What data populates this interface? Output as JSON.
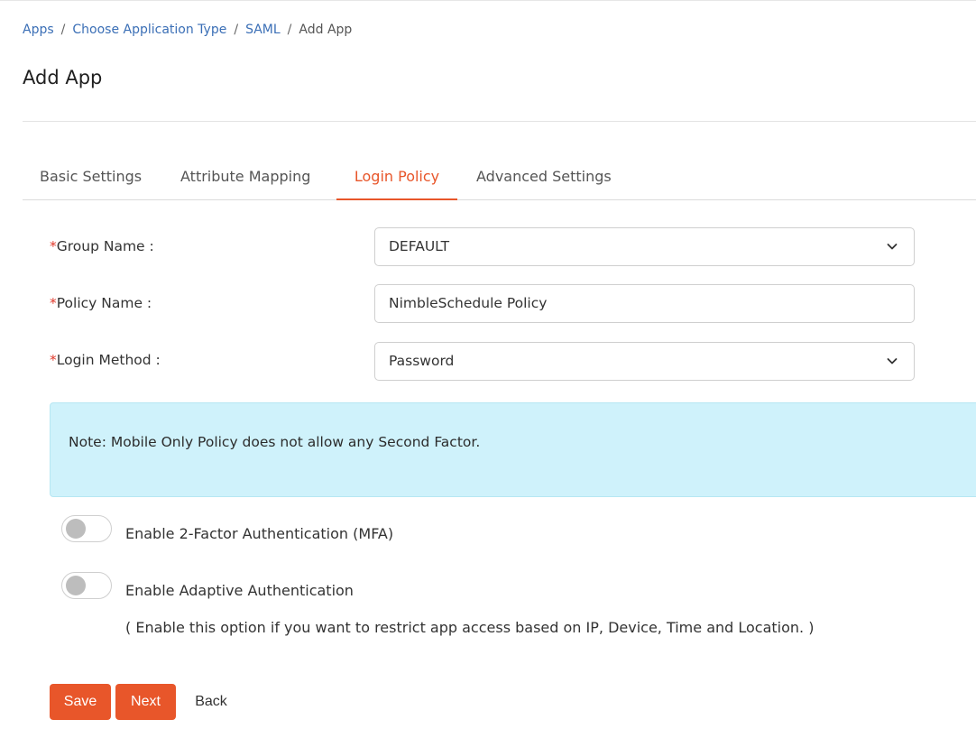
{
  "breadcrumb": {
    "items": [
      "Apps",
      "Choose Application Type",
      "SAML"
    ],
    "separator": "/",
    "current": "Add App"
  },
  "page": {
    "title": "Add App"
  },
  "tabs": [
    {
      "label": "Basic Settings",
      "active": false
    },
    {
      "label": "Attribute Mapping",
      "active": false
    },
    {
      "label": "Login Policy",
      "active": true
    },
    {
      "label": "Advanced Settings",
      "active": false
    }
  ],
  "form": {
    "required_mark": "*",
    "group_name": {
      "label": "Group Name :",
      "value": "DEFAULT",
      "icon": "chevron-down-icon"
    },
    "policy_name": {
      "label": "Policy Name :",
      "value": "NimbleSchedule Policy"
    },
    "login_method": {
      "label": "Login Method :",
      "value": "Password",
      "icon": "chevron-down-icon"
    }
  },
  "note": {
    "text": "Note: Mobile Only Policy does not allow any Second Factor."
  },
  "toggles": {
    "mfa": {
      "label": "Enable 2-Factor Authentication (MFA)",
      "enabled": false
    },
    "adaptive": {
      "label": "Enable Adaptive Authentication",
      "enabled": false,
      "hint": "( Enable this option if you want to restrict app access based on IP, Device, Time and Location. )"
    }
  },
  "actions": {
    "save": "Save",
    "next": "Next",
    "back": "Back"
  },
  "colors": {
    "accent": "#e8562a",
    "link": "#3b6fb6",
    "required": "#e0392b",
    "note_bg": "#cff2fb"
  }
}
